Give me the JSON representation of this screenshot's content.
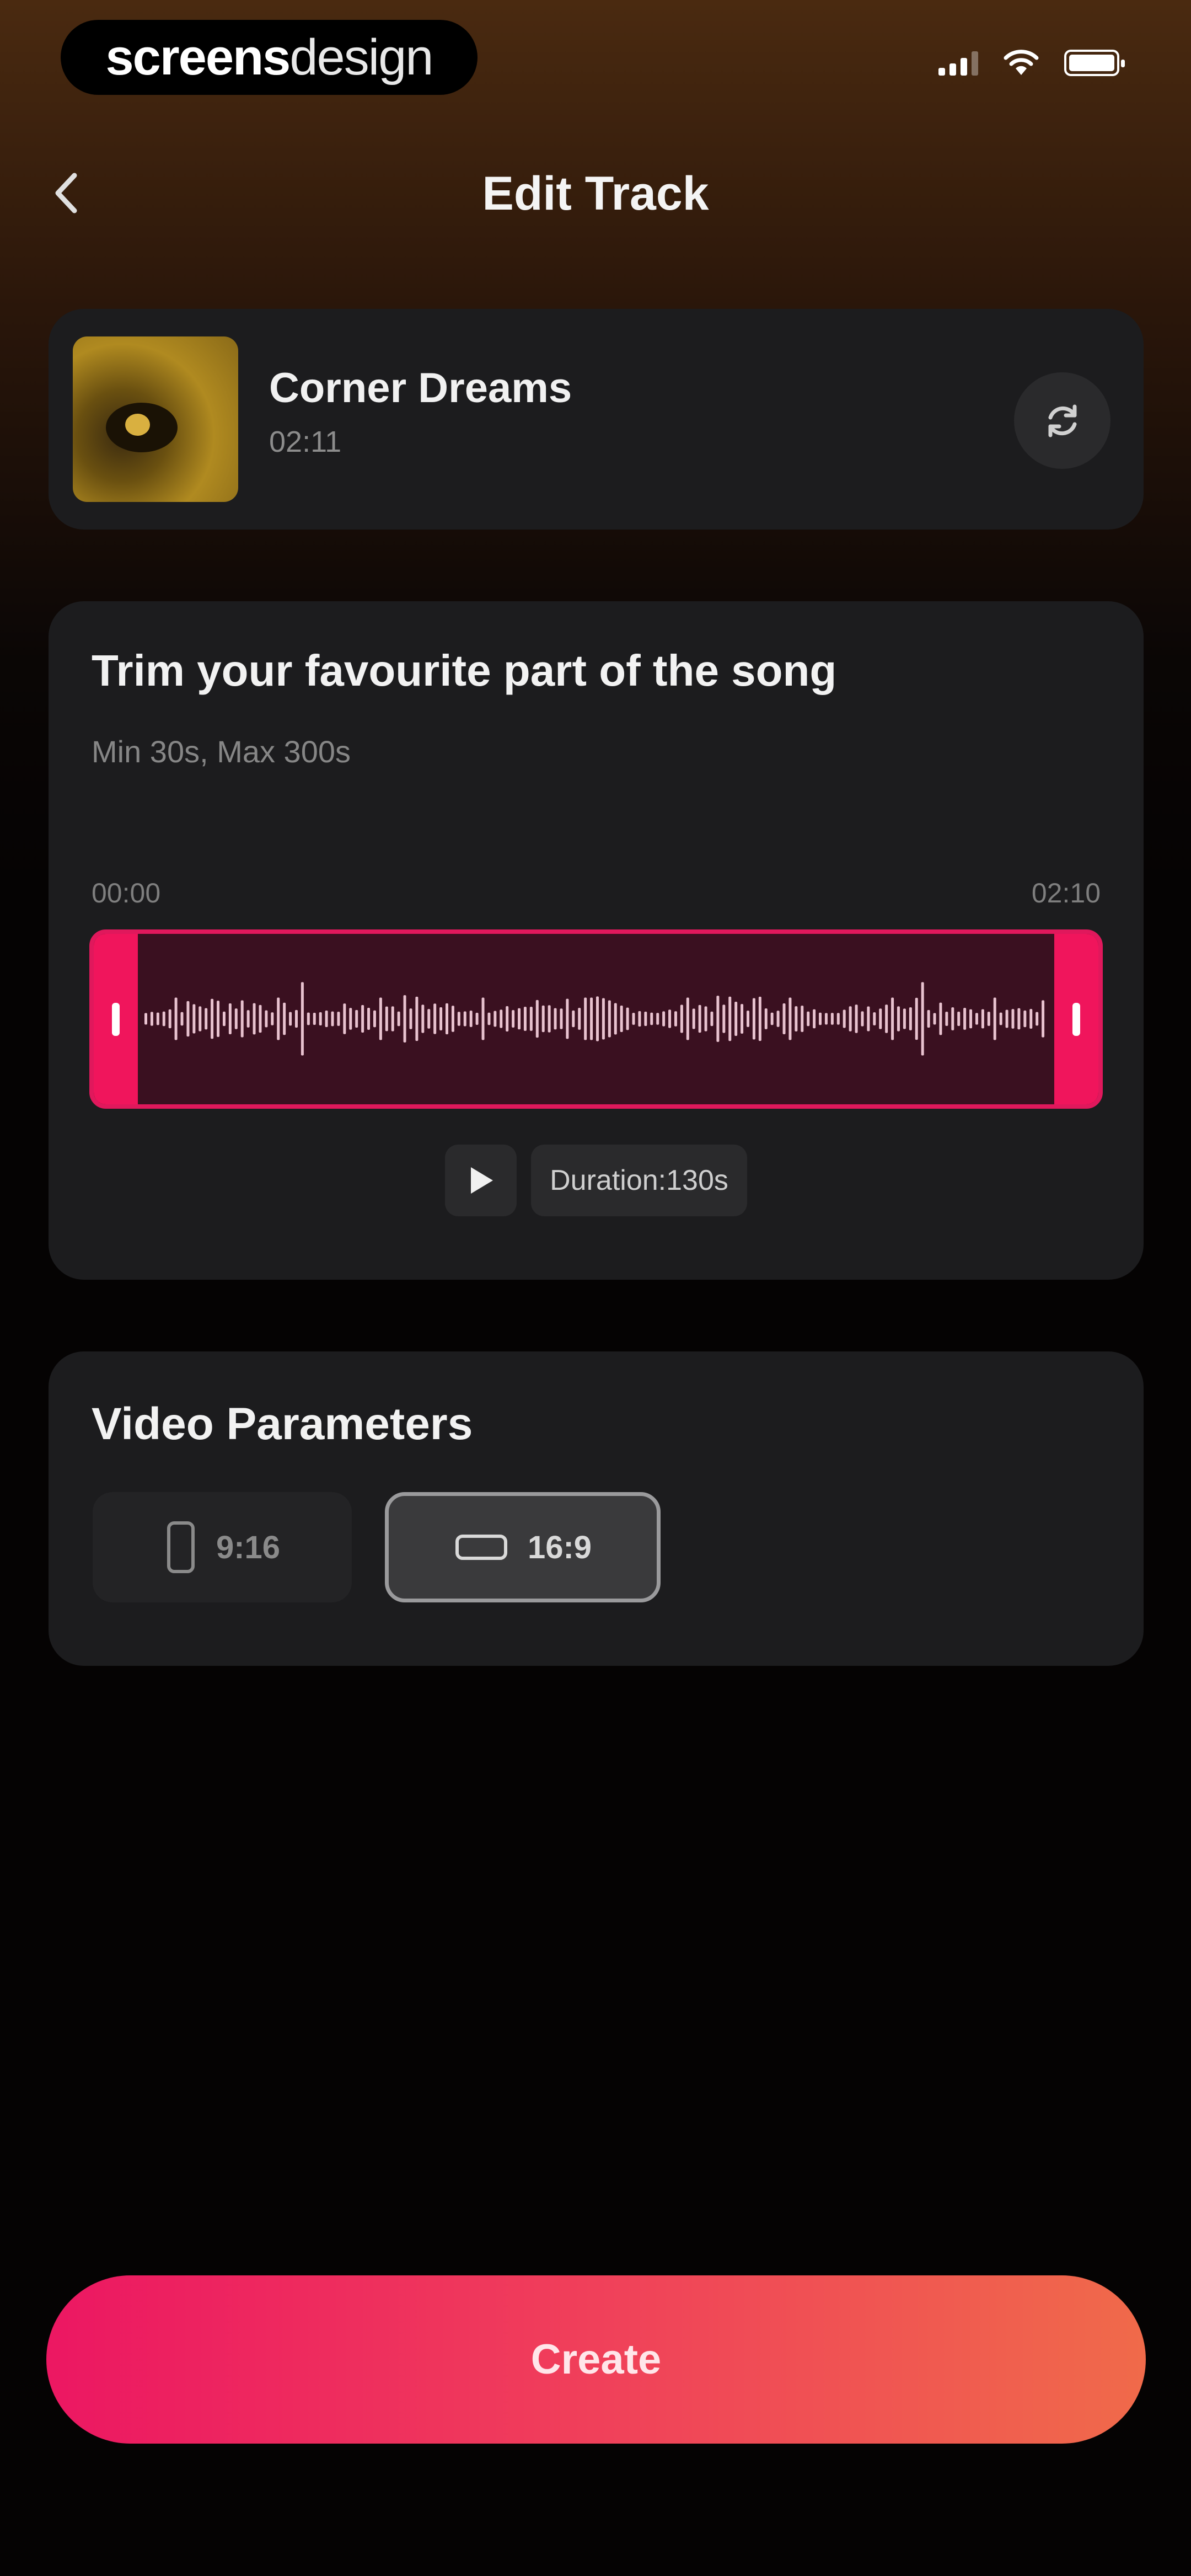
{
  "status_bar": {
    "brand_bold": "screens",
    "brand_light": "design"
  },
  "nav": {
    "title": "Edit Track"
  },
  "track": {
    "title": "Corner Dreams",
    "duration": "02:11"
  },
  "trim": {
    "title": "Trim your favourite part of the song",
    "subtitle": "Min 30s, Max 300s",
    "start_time": "00:00",
    "end_time": "02:10",
    "duration_label": "Duration:130s"
  },
  "params": {
    "title": "Video Parameters",
    "options": [
      {
        "label": "9:16",
        "selected": false
      },
      {
        "label": "16:9",
        "selected": true
      }
    ]
  },
  "actions": {
    "create_label": "Create"
  },
  "colors": {
    "accent": "#f0155c",
    "accent_end": "#f06a4a",
    "card": "#1c1c1e"
  },
  "icons": [
    "back-chevron-icon",
    "refresh-icon",
    "play-icon",
    "portrait-phone-icon",
    "landscape-phone-icon",
    "signal-icon",
    "wifi-icon",
    "battery-icon"
  ]
}
